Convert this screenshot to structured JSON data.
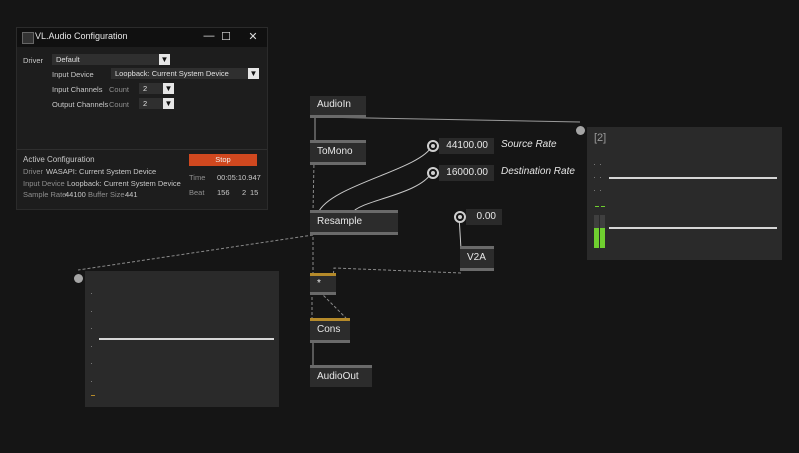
{
  "window": {
    "title": "VL.Audio Configuration",
    "controls": {
      "minimize": "—",
      "maximize": "☐",
      "close": "✕"
    },
    "driver": {
      "label": "Driver",
      "value": "Default"
    },
    "input_device": {
      "label": "Input Device",
      "value": "Loopback: Current System Device"
    },
    "input_channels": {
      "label": "Input Channels",
      "count_label": "Count",
      "value": "2"
    },
    "output_channels": {
      "label": "Output Channels",
      "count_label": "Count",
      "value": "2"
    },
    "active": {
      "heading": "Active Configuration",
      "driver_label": "Driver",
      "driver_value": "WASAPI: Current System Device",
      "input_label": "Input Device",
      "input_value": "Loopback: Current System Device",
      "rate_label": "Sample Rate",
      "rate_value": "44100",
      "buffer_label": "Buffer Size",
      "buffer_value": "441"
    },
    "stop_label": "Stop",
    "time_label": "Time",
    "time_value": "00:05:10.947",
    "beat_label": "Beat",
    "beat_value": "156",
    "beat_bar": "2",
    "beat_tick": "15"
  },
  "nodes": {
    "audioin": "AudioIn",
    "tomono": "ToMono",
    "resample": "Resample",
    "v2a": "V2A",
    "multiply": "*",
    "cons": "Cons",
    "audioout": "AudioOut"
  },
  "io_boxes": {
    "source_rate": {
      "value": "44100.00",
      "caption": "Source Rate"
    },
    "destination_rate": {
      "value": "16000.00",
      "caption": "Destination Rate"
    },
    "v2a_input": {
      "value": "0.00"
    }
  },
  "scope_panel": {
    "header": "[2]"
  },
  "icons": {
    "dropdown": "chevron-down-icon"
  },
  "colors": {
    "stop_button": "#d0481f",
    "meter": "#6fcf2f",
    "background": "#151515"
  }
}
